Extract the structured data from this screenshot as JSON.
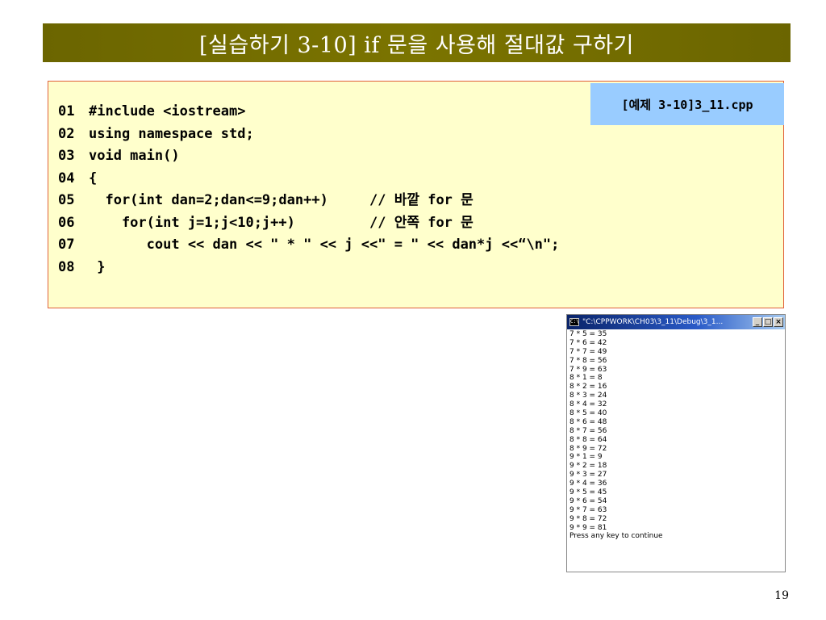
{
  "slide": {
    "title": "[실습하기 3-10] if 문을 사용해 절대값 구하기",
    "page_number": "19"
  },
  "code_box": {
    "file_label": "[예제 3-10]3_11.cpp",
    "lines": [
      {
        "num": "01",
        "code": "#include <iostream>"
      },
      {
        "num": "02",
        "code": "using namespace std;"
      },
      {
        "num": "03",
        "code": "void main()"
      },
      {
        "num": "04",
        "code": "{"
      },
      {
        "num": "05",
        "code": "  for(int dan=2;dan<=9;dan++)     // 바깥 for 문"
      },
      {
        "num": "06",
        "code": "    for(int j=1;j<10;j++)         // 안쪽 for 문"
      },
      {
        "num": "07",
        "code": "       cout << dan << \" * \" << j <<\" = \" << dan*j <<“\\n\";"
      },
      {
        "num": "08",
        "code": " }"
      }
    ]
  },
  "console": {
    "title": "\"C:\\CPPWORK\\CH03\\3_11\\Debug\\3_1...",
    "icon_text": "C:\\",
    "minimize_label": "_",
    "maximize_label": "□",
    "close_label": "×",
    "lines": [
      "7 * 5 = 35",
      "7 * 6 = 42",
      "7 * 7 = 49",
      "7 * 8 = 56",
      "7 * 9 = 63",
      "8 * 1 = 8",
      "8 * 2 = 16",
      "8 * 3 = 24",
      "8 * 4 = 32",
      "8 * 5 = 40",
      "8 * 6 = 48",
      "8 * 7 = 56",
      "8 * 8 = 64",
      "8 * 9 = 72",
      "9 * 1 = 9",
      "9 * 2 = 18",
      "9 * 3 = 27",
      "9 * 4 = 36",
      "9 * 5 = 45",
      "9 * 6 = 54",
      "9 * 7 = 63",
      "9 * 8 = 72",
      "9 * 9 = 81",
      "Press any key to continue"
    ]
  },
  "colors": {
    "title_bar": "#7b7400",
    "code_background": "#ffffcc",
    "code_border": "#e0603a",
    "file_tag_background": "#99ccff",
    "console_titlebar": "#0a246a"
  }
}
